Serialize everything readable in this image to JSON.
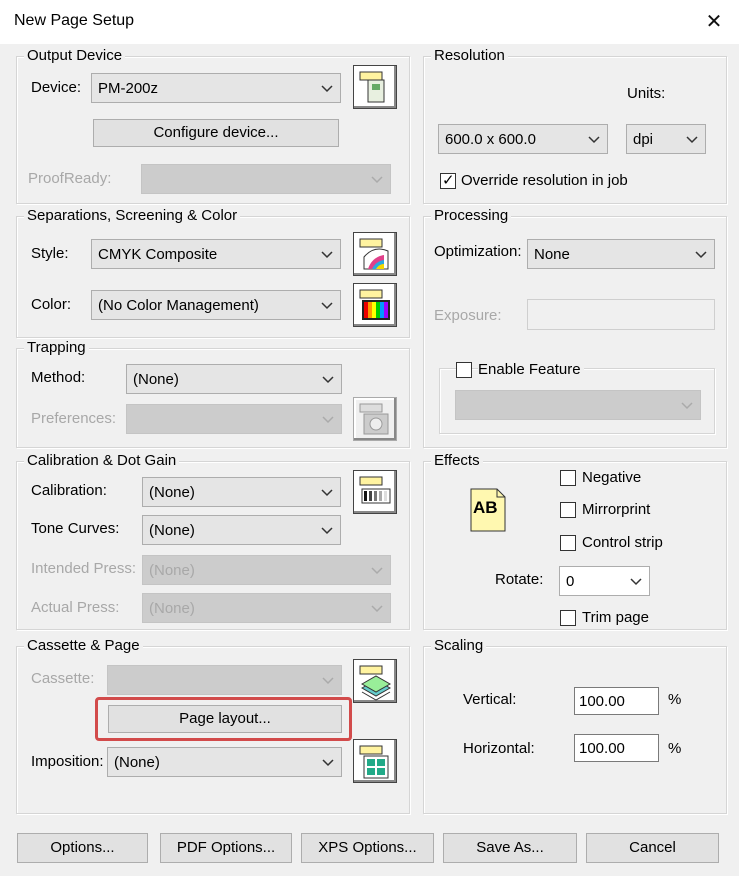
{
  "window": {
    "title": "New Page Setup",
    "close_icon": "close-icon"
  },
  "output_device": {
    "legend": "Output Device",
    "device_label": "Device:",
    "device_value": "PM-200z",
    "configure_button": "Configure device...",
    "proofready_label": "ProofReady:",
    "proofready_value": ""
  },
  "resolution": {
    "legend": "Resolution",
    "units_label": "Units:",
    "resolution_value": "600.0 x 600.0",
    "units_value": "dpi",
    "override_label": "Override resolution in job",
    "override_checked": true
  },
  "separations": {
    "legend": "Separations, Screening & Color",
    "style_label": "Style:",
    "style_value": "CMYK Composite",
    "color_label": "Color:",
    "color_value": "(No Color Management)"
  },
  "processing": {
    "legend": "Processing",
    "optimization_label": "Optimization:",
    "optimization_value": "None",
    "exposure_label": "Exposure:",
    "exposure_value": "",
    "enable_feature_label": "Enable Feature",
    "enable_feature_checked": false,
    "feature_value": ""
  },
  "trapping": {
    "legend": "Trapping",
    "method_label": "Method:",
    "method_value": "(None)",
    "preferences_label": "Preferences:",
    "preferences_value": ""
  },
  "calibration": {
    "legend": "Calibration & Dot Gain",
    "calibration_label": "Calibration:",
    "calibration_value": "(None)",
    "tone_curves_label": "Tone Curves:",
    "tone_curves_value": "(None)",
    "intended_press_label": "Intended Press:",
    "intended_press_value": "(None)",
    "actual_press_label": "Actual Press:",
    "actual_press_value": "(None)"
  },
  "effects": {
    "legend": "Effects",
    "preview_text": "AB",
    "negative_label": "Negative",
    "mirrorprint_label": "Mirrorprint",
    "control_strip_label": "Control strip",
    "rotate_label": "Rotate:",
    "rotate_value": "0",
    "trim_page_label": "Trim page"
  },
  "cassette": {
    "legend": "Cassette & Page",
    "cassette_label": "Cassette:",
    "cassette_value": "",
    "page_layout_button": "Page layout...",
    "imposition_label": "Imposition:",
    "imposition_value": "(None)"
  },
  "scaling": {
    "legend": "Scaling",
    "vertical_label": "Vertical:",
    "vertical_value": "100.00",
    "horizontal_label": "Horizontal:",
    "horizontal_value": "100.00",
    "percent_symbol": "%"
  },
  "footer": {
    "options_button": "Options...",
    "pdf_options_button": "PDF Options...",
    "xps_options_button": "XPS Options...",
    "save_as_button": "Save As...",
    "cancel_button": "Cancel"
  },
  "colors": {
    "highlight": "#d24b4b",
    "dialog_bg": "#f0f0f0"
  }
}
